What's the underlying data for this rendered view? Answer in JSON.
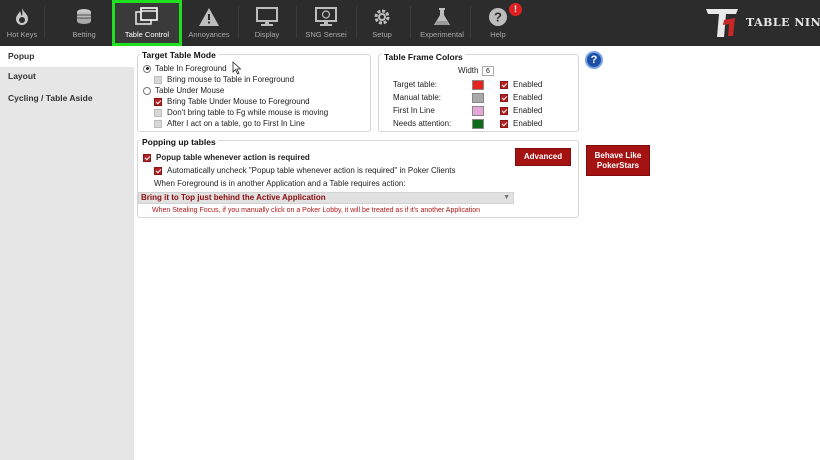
{
  "toolbar": {
    "buttons": [
      {
        "label": "Hot Keys",
        "icon": "flame-icon"
      },
      {
        "label": "Betting",
        "icon": "chips-icon"
      },
      {
        "label": "Table Control",
        "icon": "windows-icon"
      },
      {
        "label": "Annoyances",
        "icon": "warning-icon"
      },
      {
        "label": "Display",
        "icon": "monitor-icon"
      },
      {
        "label": "SNG Sensei",
        "icon": "sng-monitor-icon"
      },
      {
        "label": "Setup",
        "icon": "gear-icon"
      },
      {
        "label": "Experimental",
        "icon": "flask-icon"
      },
      {
        "label": "Help",
        "icon": "help-icon"
      }
    ],
    "help_badge": "!",
    "active_color": "#1ee01e"
  },
  "logo": {
    "monogram": "TN",
    "sub": "II",
    "text": "TABLE NINJA"
  },
  "sidebar": {
    "items": [
      {
        "label": "Popup"
      },
      {
        "label": "Layout"
      },
      {
        "label": "Cycling / Table Aside"
      }
    ]
  },
  "target_mode": {
    "title": "Target Table Mode",
    "opt1": "Table In Foreground",
    "opt1_sub": "Bring mouse to Table in Foreground",
    "opt2": "Table Under Mouse",
    "opt2_sub1": "Bring Table Under Mouse to Foreground",
    "opt2_sub2": "Don't bring table to Fg while mouse is moving",
    "opt2_sub3": "After I act on a table, go to First In Line"
  },
  "frame_colors": {
    "title": "Table Frame Colors",
    "width_label": "Width",
    "width_value": "6",
    "rows": [
      {
        "label": "Target table:",
        "color": "#e8231b",
        "enabled": "Enabled"
      },
      {
        "label": "Manual table:",
        "color": "#a9a9a9",
        "enabled": "Enabled"
      },
      {
        "label": "First In Line",
        "color": "#e6a8d8",
        "enabled": "Enabled"
      },
      {
        "label": "Needs attention:",
        "color": "#0f6b1a",
        "enabled": "Enabled"
      }
    ]
  },
  "popping": {
    "title": "Popping up tables",
    "main_check": "Popup table whenever action is required",
    "sub_check": "Automatically uncheck \"Popup table whenever action is required\" in Poker Clients",
    "when_text": "When Foreground is in another Application and a Table requires action:",
    "select_value": "Bring it to Top just behind the Active Application",
    "note": "When Stealing Focus, if you manually click on a Poker Lobby, it will be treated as if it's another Application",
    "advanced_label": "Advanced",
    "behave_label": "Behave Like PokerStars"
  },
  "help_button": "?"
}
